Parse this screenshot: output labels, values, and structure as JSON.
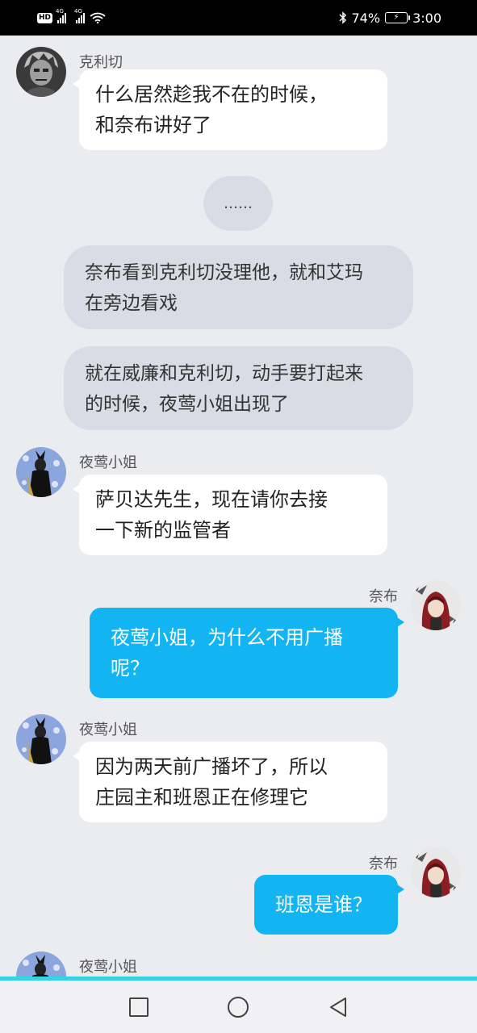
{
  "status_bar": {
    "hd": "HD",
    "sim1": "4G",
    "sim2": "4G",
    "battery_percent": "74%",
    "time": "3:00"
  },
  "messages": [
    {
      "type": "left",
      "sender": "克利切",
      "lines": [
        "什么居然趁我不在的时候，",
        "和奈布讲好了"
      ],
      "avatar": "kreacher-avatar"
    },
    {
      "type": "ellipsis",
      "text": "……"
    },
    {
      "type": "narration",
      "lines": [
        "奈布看到克利切没理他，就和艾玛",
        "在旁边看戏"
      ]
    },
    {
      "type": "narration",
      "lines": [
        "就在威廉和克利切，动手要打起来",
        "的时候，夜莺小姐出现了"
      ]
    },
    {
      "type": "left",
      "sender": "夜莺小姐",
      "lines": [
        "萨贝达先生，现在请你去接",
        "一下新的监管者"
      ],
      "avatar": "nightingale-avatar"
    },
    {
      "type": "right",
      "sender": "奈布",
      "lines": [
        "夜莺小姐，为什么不用广播",
        "呢？"
      ],
      "avatar": "naib-avatar"
    },
    {
      "type": "left",
      "sender": "夜莺小姐",
      "lines": [
        "因为两天前广播坏了，所以",
        "庄园主和班恩正在修理它"
      ],
      "avatar": "nightingale-avatar"
    },
    {
      "type": "right",
      "sender": "奈布",
      "lines": [
        "班恩是谁？"
      ],
      "avatar": "naib-avatar"
    },
    {
      "type": "left",
      "sender": "夜莺小姐",
      "lines": [],
      "avatar": "nightingale-avatar"
    }
  ],
  "colors": {
    "background": "#ebecef",
    "bubble_blue": "#12b5f2",
    "bubble_white": "#ffffff",
    "narration": "#d9dce4",
    "nav_accent": "#35d3ea"
  },
  "nav": {
    "recent": "square-icon",
    "home": "circle-icon",
    "back": "triangle-back-icon"
  }
}
